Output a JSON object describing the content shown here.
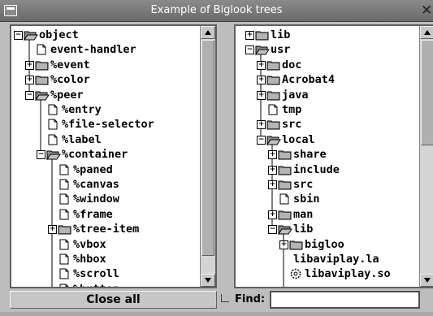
{
  "window": {
    "title": "Example of Biglook trees",
    "close_glyph": "✕"
  },
  "left_tree": [
    {
      "label": "object",
      "icon": "folder-open",
      "toggle": "−",
      "depth": 0
    },
    {
      "label": "event-handler",
      "icon": "file",
      "toggle": "",
      "depth": 1
    },
    {
      "label": "%event",
      "icon": "folder",
      "toggle": "+",
      "depth": 1
    },
    {
      "label": "%color",
      "icon": "folder",
      "toggle": "+",
      "depth": 1
    },
    {
      "label": "%peer",
      "icon": "folder-open",
      "toggle": "−",
      "depth": 1
    },
    {
      "label": "%entry",
      "icon": "file",
      "toggle": "",
      "depth": 2
    },
    {
      "label": "%file-selector",
      "icon": "file",
      "toggle": "",
      "depth": 2
    },
    {
      "label": "%label",
      "icon": "file",
      "toggle": "",
      "depth": 2
    },
    {
      "label": "%container",
      "icon": "folder-open",
      "toggle": "−",
      "depth": 2
    },
    {
      "label": "%paned",
      "icon": "file",
      "toggle": "",
      "depth": 3
    },
    {
      "label": "%canvas",
      "icon": "file",
      "toggle": "",
      "depth": 3
    },
    {
      "label": "%window",
      "icon": "file",
      "toggle": "",
      "depth": 3
    },
    {
      "label": "%frame",
      "icon": "file",
      "toggle": "",
      "depth": 3
    },
    {
      "label": "%tree-item",
      "icon": "folder",
      "toggle": "+",
      "depth": 3
    },
    {
      "label": "%vbox",
      "icon": "file",
      "toggle": "",
      "depth": 3
    },
    {
      "label": "%hbox",
      "icon": "file",
      "toggle": "",
      "depth": 3
    },
    {
      "label": "%scroll",
      "icon": "file",
      "toggle": "",
      "depth": 3
    },
    {
      "label": "%button",
      "icon": "file",
      "toggle": "",
      "depth": 3
    }
  ],
  "right_tree": [
    {
      "label": "lib",
      "icon": "folder",
      "toggle": "+",
      "depth": 0
    },
    {
      "label": "usr",
      "icon": "folder-open",
      "toggle": "−",
      "depth": 0
    },
    {
      "label": "doc",
      "icon": "folder",
      "toggle": "+",
      "depth": 1
    },
    {
      "label": "Acrobat4",
      "icon": "folder",
      "toggle": "+",
      "depth": 1
    },
    {
      "label": "java",
      "icon": "folder",
      "toggle": "+",
      "depth": 1
    },
    {
      "label": "tmp",
      "icon": "file",
      "toggle": "",
      "depth": 1
    },
    {
      "label": "src",
      "icon": "folder",
      "toggle": "+",
      "depth": 1
    },
    {
      "label": "local",
      "icon": "folder-open",
      "toggle": "−",
      "depth": 1
    },
    {
      "label": "share",
      "icon": "folder",
      "toggle": "+",
      "depth": 2
    },
    {
      "label": "include",
      "icon": "folder",
      "toggle": "+",
      "depth": 2
    },
    {
      "label": "src",
      "icon": "folder",
      "toggle": "+",
      "depth": 2
    },
    {
      "label": "sbin",
      "icon": "file",
      "toggle": "",
      "depth": 2
    },
    {
      "label": "man",
      "icon": "folder",
      "toggle": "+",
      "depth": 2
    },
    {
      "label": "lib",
      "icon": "folder-open",
      "toggle": "−",
      "depth": 2
    },
    {
      "label": "bigloo",
      "icon": "folder",
      "toggle": "+",
      "depth": 3
    },
    {
      "label": "libaviplay.la",
      "icon": "none",
      "toggle": "",
      "depth": 3
    },
    {
      "label": "libaviplay.so",
      "icon": "gear",
      "toggle": "",
      "depth": 3
    }
  ],
  "controls": {
    "close_all_label": "Close all",
    "find_label": "Find:",
    "find_value": ""
  }
}
